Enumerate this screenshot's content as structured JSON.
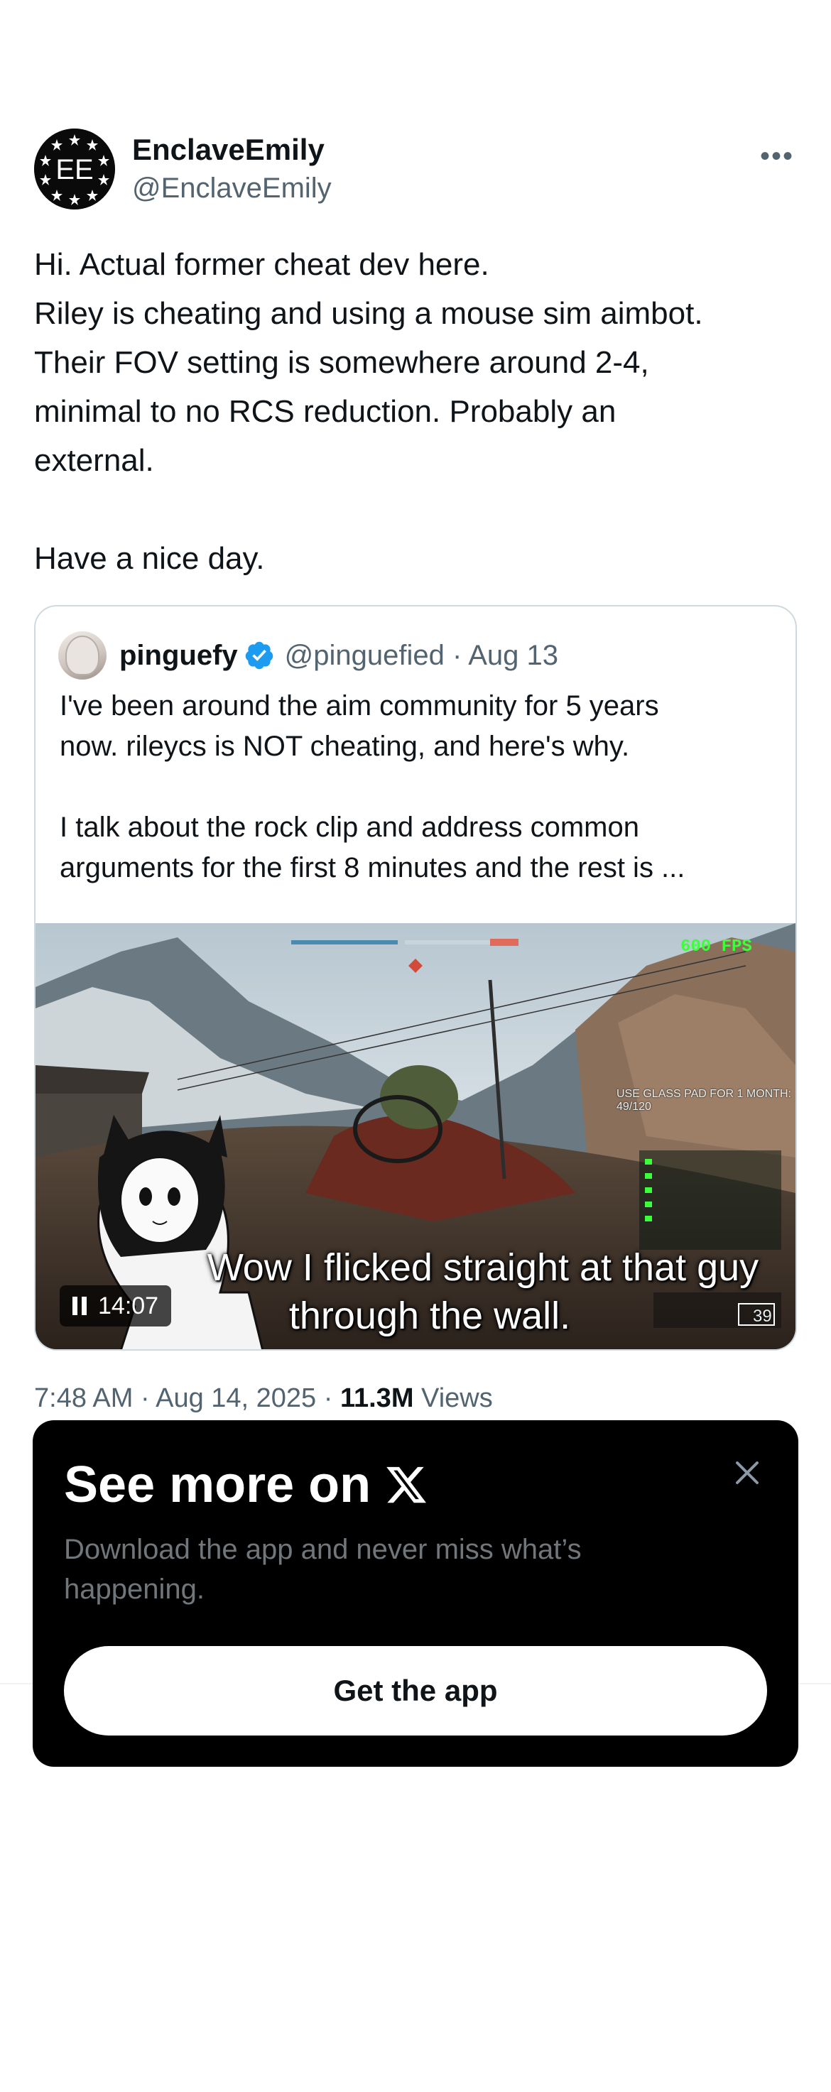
{
  "tweet": {
    "display_name": "EnclaveEmily",
    "handle": "@EnclaveEmily",
    "avatar_text": "EE",
    "more_icon": "ellipsis-icon",
    "text": "Hi. Actual former cheat dev here.\nRiley is cheating and using a mouse sim aimbot.\nTheir FOV setting is somewhere around 2-4,\nminimal to no RCS reduction. Probably an\nexternal.\n\nHave a nice day.",
    "timestamp": "7:48 AM · Aug 14, 2025 · ",
    "views_count": "11.3M",
    "views_label": " Views"
  },
  "quote": {
    "display_name": "pinguefy",
    "verified_icon": "verified-badge-icon",
    "handle_date": "@pinguefied · Aug 13",
    "text": "I've been around the aim community for 5 years\nnow. rileycs is NOT cheating, and here's why.\n\nI talk about the rock clip and address common\narguments for the first 8 minutes and the rest is ...",
    "video": {
      "duration": "14:07",
      "caption_line1": "Wow I flicked straight at that guy",
      "caption_line2": "through the wall.",
      "hud_fps": "600 FPS",
      "hud_ammo": "39",
      "hud_banner": "USE GLASS PAD FOR 1 MONTH: 49/120"
    }
  },
  "modal": {
    "title": "See more on",
    "subtitle": "Download the app and never miss what’s happening.",
    "button_label": "Get the app",
    "close_icon": "close-icon",
    "logo_icon": "x-logo-icon"
  },
  "colors": {
    "text_primary": "#0f1419",
    "text_secondary": "#536471",
    "verified_blue": "#1d9bf0",
    "modal_bg": "#000000",
    "modal_sub": "#71767b"
  }
}
